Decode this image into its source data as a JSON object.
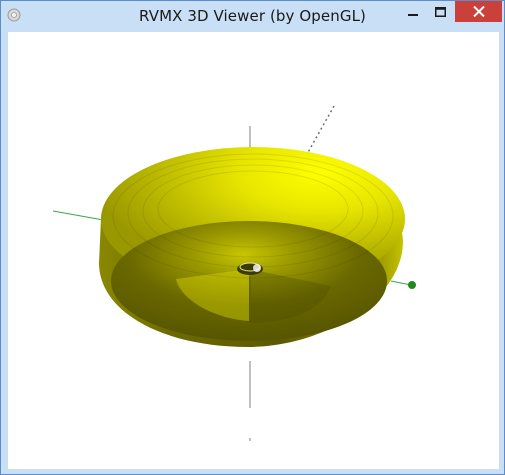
{
  "window": {
    "title": "RVMX 3D Viewer (by OpenGL)",
    "icon": "app-icon",
    "controls": [
      "minimize-icon",
      "maximize-icon",
      "close-icon"
    ],
    "colors": {
      "frame": "#c9dff6",
      "close_button": "#c9413a",
      "viewport_background": "#ffffff"
    }
  },
  "viewport": {
    "content": "3d-rendered-shape",
    "colors": {
      "shape_light": "#ffff00",
      "shape_mid": "#d4d200",
      "shape_dark": "#5c5a00",
      "axis_green": "#39a845",
      "axis_gray": "#808080",
      "marker": "#1f8a1f"
    }
  }
}
